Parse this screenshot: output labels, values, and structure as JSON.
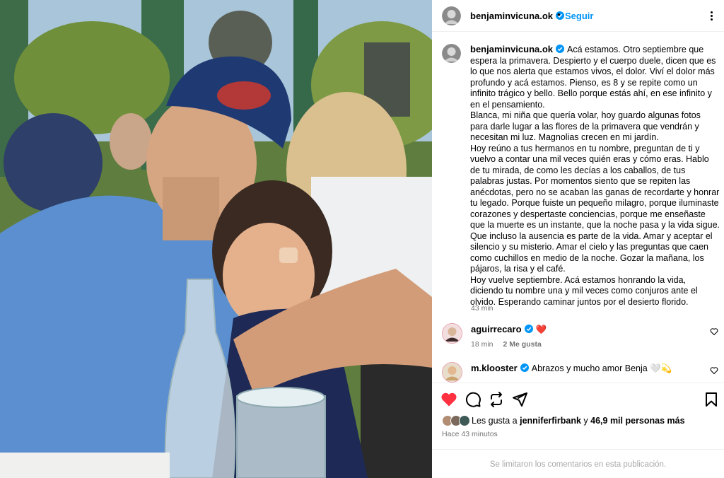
{
  "photo": {
    "description_icon": "photo-image"
  },
  "post": {
    "username": "benjaminvicuna.ok",
    "follow_label": "Seguir",
    "dot": "•",
    "caption_paragraphs": [
      "Acá estamos. Otro septiembre que espera la primavera. Despierto y el cuerpo duele, dicen que es lo que nos alerta que estamos vivos, el dolor. Viví el dolor más profundo y acá estamos. Pienso, es 8 y se repite como un infinito trágico y bello. Bello porque estás ahí, en ese infinito y en el pensamiento.",
      "Blanca, mi niña que quería volar, hoy guardo algunas fotos para darle lugar a las flores de la primavera que vendrán y necesitan mi luz. Magnolias crecen en mi jardín.",
      "Hoy reúno a tus hermanos en tu nombre, preguntan de ti y vuelvo a contar una mil veces quién eras y cómo eras. Hablo de tu mirada, de como les decías a los caballos, de tus palabras justas. Por momentos siento que se repiten las anécdotas, pero no se acaban las ganas de recordarte y honrar tu legado. Porque fuiste un pequeño milagro, porque iluminaste corazones y despertaste conciencias, porque me enseñaste que la muerte es un instante, que la noche pasa y la vida sigue. Que incluso la ausencia es parte de la vida. Amar y aceptar el silencio y su misterio. Amar el cielo y las preguntas que caen como cuchillos en medio de la noche. Gozar la mañana, los pájaros, la risa y el café.",
      "Hoy vuelve septiembre. Acá estamos honrando la vida, diciendo tu nombre una y mil veces como conjuros ante el olvido. Esperando caminar juntos por el desierto florido."
    ],
    "caption_time": "43 min"
  },
  "comments": [
    {
      "username": "aguirrecaro",
      "text": "❤️",
      "time": "18 min",
      "likes": "2 Me gusta"
    },
    {
      "username": "m.klooster",
      "text": "Abrazos y mucho amor Benja 🤍💫",
      "time": "",
      "likes": ""
    }
  ],
  "actions": {
    "likes_prefix": "Les gusta a ",
    "likes_user": "jenniferfirbank",
    "likes_mid": " y ",
    "likes_count": "46,9 mil personas más",
    "posted_ago": "Hace 43 minutos"
  },
  "comments_limited": "Se limitaron los comentarios en esta publicación.",
  "colors": {
    "accent": "#0095f6",
    "like_red": "#ff3040",
    "verified": "#0095f6",
    "muted": "#737373"
  }
}
